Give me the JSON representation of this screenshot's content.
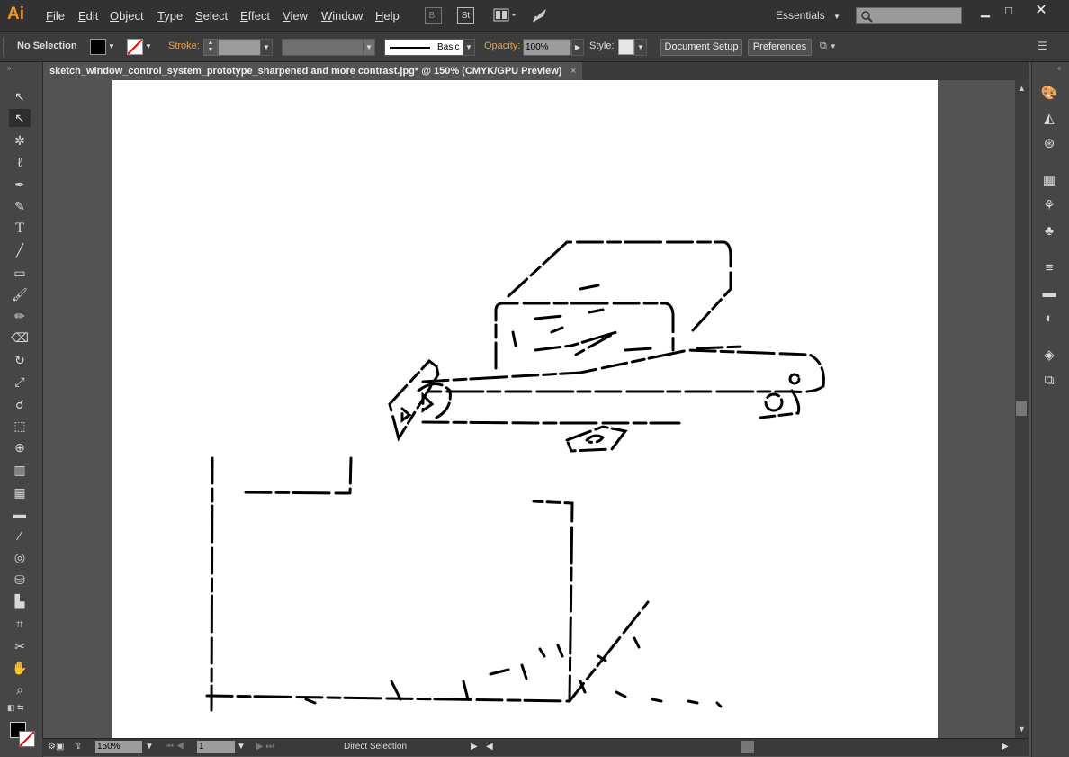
{
  "app": {
    "logo": "Ai"
  },
  "menu": [
    "File",
    "Edit",
    "Object",
    "Type",
    "Select",
    "Effect",
    "View",
    "Window",
    "Help"
  ],
  "menubar_buttons": {
    "bridge": "Br",
    "stock": "St"
  },
  "workspace": "Essentials",
  "control": {
    "selection": "No Selection",
    "stroke_label": "Stroke:",
    "brush": "Basic",
    "opacity_label": "Opacity:",
    "opacity_value": "100%",
    "style_label": "Style:",
    "document_setup": "Document Setup",
    "preferences": "Preferences"
  },
  "document_tab": {
    "title": "sketch_window_control_system_prototype_sharpened and more contrast.jpg* @ 150% (CMYK/GPU Preview)",
    "close": "×"
  },
  "status": {
    "zoom": "150%",
    "artboard": "1",
    "tool": "Direct Selection"
  },
  "icons": {
    "selection": "selection-arrow-icon",
    "direct": "direct-selection-icon",
    "wand": "magic-wand-icon",
    "lasso": "lasso-icon",
    "pen": "pen-icon",
    "curvature": "curvature-icon",
    "type": "type-icon",
    "line": "line-icon",
    "rect": "rectangle-icon",
    "paintbrush": "paintbrush-icon",
    "pencil": "pencil-icon",
    "eraser": "eraser-icon",
    "rotate": "rotate-icon",
    "scale": "scale-icon",
    "warp": "warp-icon",
    "freetransform": "free-transform-icon",
    "shapebuilder": "shape-builder-icon",
    "graph": "graph-icon",
    "mesh": "mesh-icon",
    "gradient": "gradient-icon",
    "eyedropper": "eyedropper-icon",
    "blend": "blend-icon",
    "symbol": "symbol-sprayer-icon",
    "column": "column-graph-icon",
    "artboard": "artboard-icon",
    "slice": "slice-icon",
    "hand": "hand-icon",
    "zoom": "zoom-icon"
  },
  "colors": {
    "fill": "#000000",
    "stroke": "none",
    "accent": "#f7931e"
  }
}
